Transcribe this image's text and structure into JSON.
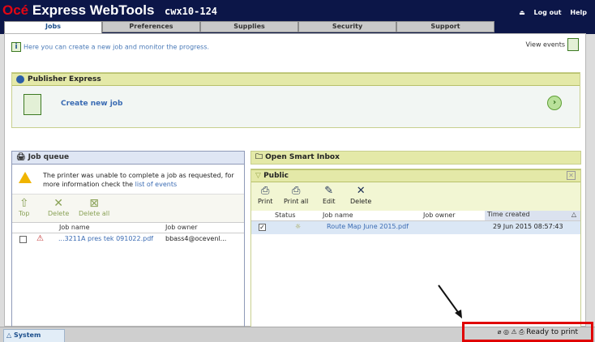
{
  "header": {
    "brand_prefix": "Océ",
    "brand_rest": "Express WebTools",
    "hostname": "cwx10-124",
    "logout_label": "Log out",
    "help_label": "Help"
  },
  "tabs": [
    {
      "label": "Jobs",
      "active": true
    },
    {
      "label": "Preferences"
    },
    {
      "label": "Supplies"
    },
    {
      "label": "Security"
    },
    {
      "label": "Support"
    }
  ],
  "intro": {
    "text": "Here you can create a new job and monitor the progress.",
    "view_events": "View events"
  },
  "publisher": {
    "title": "Publisher Express",
    "create_label": "Create new job"
  },
  "job_queue": {
    "title": "Job queue",
    "warning_text": "The printer was unable to complete a job as requested, for more information check the",
    "warning_link": "list of events",
    "tools": {
      "top": "Top",
      "delete": "Delete",
      "delete_all": "Delete all"
    },
    "columns": {
      "job_name": "Job name",
      "job_owner": "Job owner"
    },
    "rows": [
      {
        "job_name": "...3211A pres tek 091022.pdf",
        "job_owner": "bbass4@ocevenl..."
      }
    ]
  },
  "smart_inbox": {
    "title": "Open Smart Inbox"
  },
  "public_box": {
    "title": "Public",
    "tools": {
      "print": "Print",
      "print_all": "Print all",
      "edit": "Edit",
      "delete": "Delete"
    },
    "columns": {
      "status": "Status",
      "job_name": "Job name",
      "job_owner": "Job owner",
      "time_created": "Time created"
    },
    "rows": [
      {
        "job_name": "Route Map June 2015.pdf",
        "time_created": "29 Jun 2015 08:57:43"
      }
    ]
  },
  "status_bar": {
    "system_tab": "System",
    "printer_status": "Ready to print"
  },
  "colors": {
    "header_bg": "#0c1648",
    "brand_red": "#e30613",
    "section_yellow": "#e4e9a8",
    "highlight_red": "#e00000"
  }
}
